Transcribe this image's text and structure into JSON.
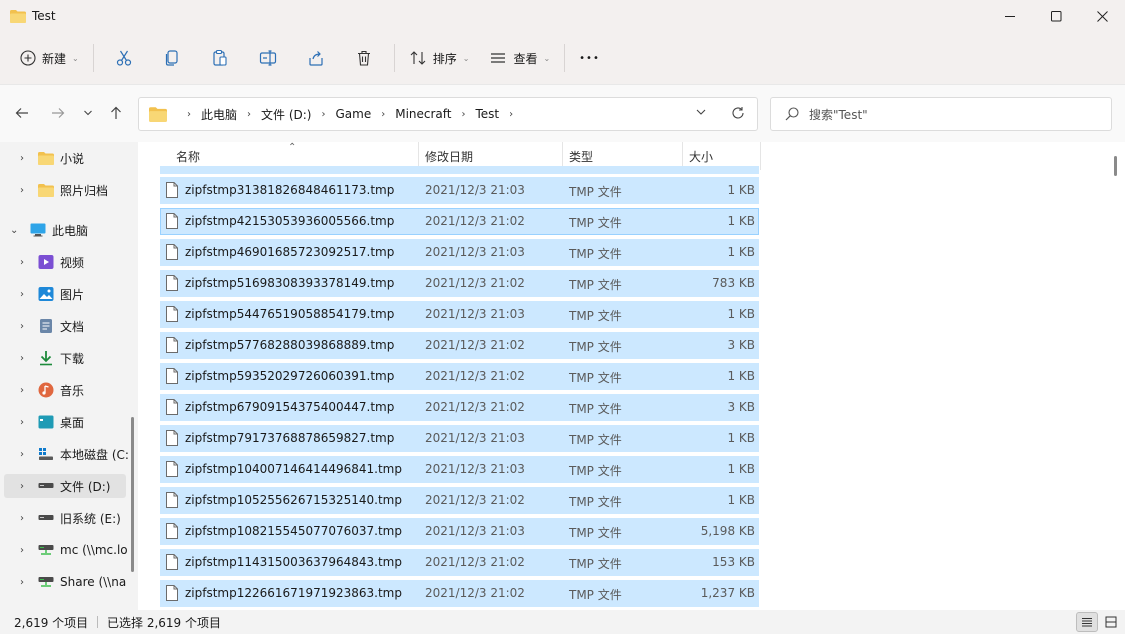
{
  "window": {
    "title": "Test"
  },
  "toolbar": {
    "new_label": "新建",
    "sort_label": "排序",
    "view_label": "查看",
    "more_label": "•••"
  },
  "address": {
    "crumbs": [
      "此电脑",
      "文件 (D:)",
      "Game",
      "Minecraft",
      "Test"
    ]
  },
  "search": {
    "placeholder": "搜索\"Test\""
  },
  "sidebar": {
    "items": [
      {
        "label": "小说",
        "icon": "folder-icon",
        "indent": 1
      },
      {
        "label": "照片归档",
        "icon": "folder-icon",
        "indent": 1
      },
      {
        "label": "此电脑",
        "icon": "computer-icon",
        "indent": 0,
        "expanded": true
      },
      {
        "label": "视频",
        "icon": "video-icon",
        "indent": 1
      },
      {
        "label": "图片",
        "icon": "picture-icon",
        "indent": 1
      },
      {
        "label": "文档",
        "icon": "document-icon",
        "indent": 1
      },
      {
        "label": "下载",
        "icon": "download-icon",
        "indent": 1
      },
      {
        "label": "音乐",
        "icon": "music-icon",
        "indent": 1
      },
      {
        "label": "桌面",
        "icon": "desktop-icon",
        "indent": 1
      },
      {
        "label": "本地磁盘 (C:",
        "icon": "windows-drive-icon",
        "indent": 1
      },
      {
        "label": "文件 (D:)",
        "icon": "drive-icon",
        "indent": 1,
        "selected": true
      },
      {
        "label": "旧系统 (E:)",
        "icon": "drive-icon",
        "indent": 1
      },
      {
        "label": "mc (\\\\mc.lo",
        "icon": "network-drive-icon",
        "indent": 1
      },
      {
        "label": "Share (\\\\na",
        "icon": "network-drive-icon",
        "indent": 1
      }
    ]
  },
  "columns": {
    "name": "名称",
    "modified": "修改日期",
    "type": "类型",
    "size": "大小"
  },
  "files": [
    {
      "name": "zipfstmp31381826848461173.tmp",
      "date": "2021/12/3 21:03",
      "type": "TMP 文件",
      "size": "1 KB"
    },
    {
      "name": "zipfstmp42153053936005566.tmp",
      "date": "2021/12/3 21:02",
      "type": "TMP 文件",
      "size": "1 KB"
    },
    {
      "name": "zipfstmp46901685723092517.tmp",
      "date": "2021/12/3 21:03",
      "type": "TMP 文件",
      "size": "1 KB"
    },
    {
      "name": "zipfstmp51698308393378149.tmp",
      "date": "2021/12/3 21:02",
      "type": "TMP 文件",
      "size": "783 KB"
    },
    {
      "name": "zipfstmp54476519058854179.tmp",
      "date": "2021/12/3 21:03",
      "type": "TMP 文件",
      "size": "1 KB"
    },
    {
      "name": "zipfstmp57768288039868889.tmp",
      "date": "2021/12/3 21:02",
      "type": "TMP 文件",
      "size": "3 KB"
    },
    {
      "name": "zipfstmp59352029726060391.tmp",
      "date": "2021/12/3 21:02",
      "type": "TMP 文件",
      "size": "1 KB"
    },
    {
      "name": "zipfstmp67909154375400447.tmp",
      "date": "2021/12/3 21:02",
      "type": "TMP 文件",
      "size": "3 KB"
    },
    {
      "name": "zipfstmp79173768878659827.tmp",
      "date": "2021/12/3 21:03",
      "type": "TMP 文件",
      "size": "1 KB"
    },
    {
      "name": "zipfstmp104007146414496841.tmp",
      "date": "2021/12/3 21:03",
      "type": "TMP 文件",
      "size": "1 KB"
    },
    {
      "name": "zipfstmp105255626715325140.tmp",
      "date": "2021/12/3 21:02",
      "type": "TMP 文件",
      "size": "1 KB"
    },
    {
      "name": "zipfstmp108215545077076037.tmp",
      "date": "2021/12/3 21:03",
      "type": "TMP 文件",
      "size": "5,198 KB"
    },
    {
      "name": "zipfstmp114315003637964843.tmp",
      "date": "2021/12/3 21:02",
      "type": "TMP 文件",
      "size": "153 KB"
    },
    {
      "name": "zipfstmp122661671971923863.tmp",
      "date": "2021/12/3 21:02",
      "type": "TMP 文件",
      "size": "1,237 KB"
    }
  ],
  "status": {
    "item_count": "2,619 个项目",
    "selected_count": "已选择 2,619 个项目"
  },
  "colors": {
    "selection": "#cce8ff",
    "selection_border": "#99d1ff",
    "folder": "#f2c14e",
    "accent": "#0067c0"
  }
}
